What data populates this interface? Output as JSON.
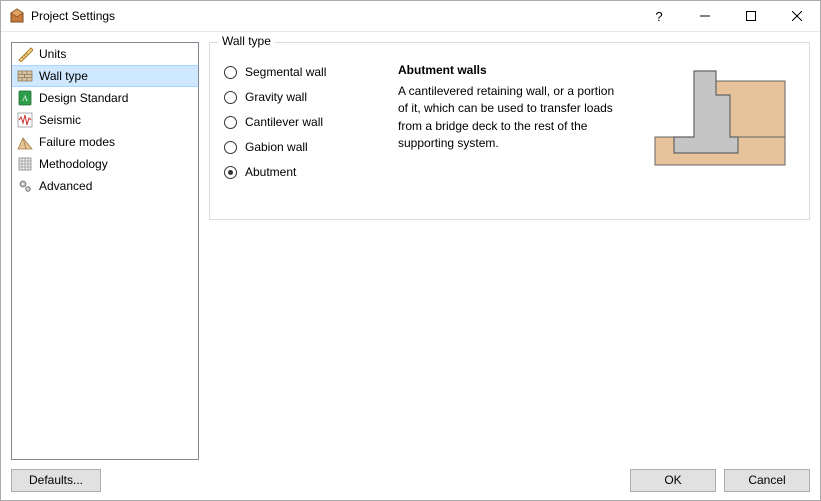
{
  "window": {
    "title": "Project Settings"
  },
  "sidebar": {
    "items": [
      {
        "label": "Units"
      },
      {
        "label": "Wall type"
      },
      {
        "label": "Design Standard"
      },
      {
        "label": "Seismic"
      },
      {
        "label": "Failure modes"
      },
      {
        "label": "Methodology"
      },
      {
        "label": "Advanced"
      }
    ]
  },
  "group": {
    "legend": "Wall type"
  },
  "radios": {
    "items": [
      {
        "label": "Segmental wall"
      },
      {
        "label": "Gravity wall"
      },
      {
        "label": "Cantilever wall"
      },
      {
        "label": "Gabion wall"
      },
      {
        "label": "Abutment"
      }
    ]
  },
  "description": {
    "title": "Abutment walls",
    "text": "A cantilevered retaining wall, or a portion of it, which can be used to transfer loads from a bridge deck to the rest of the supporting system."
  },
  "footer": {
    "defaults": "Defaults...",
    "ok": "OK",
    "cancel": "Cancel"
  }
}
